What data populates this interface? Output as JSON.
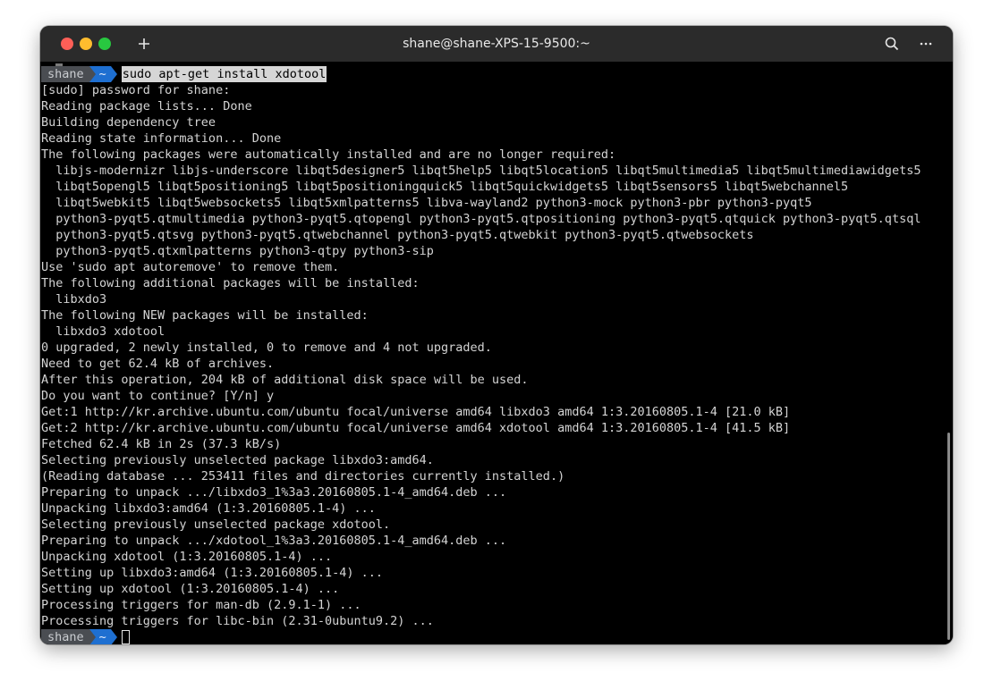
{
  "window": {
    "title": "shane@shane-XPS-15-9500:~",
    "new_tab_icon": "plus-icon",
    "search_icon": "search-icon",
    "menu_icon": "more-horizontal-icon"
  },
  "prompt": {
    "user": "shane",
    "dir": "~",
    "command": "sudo apt-get install xdotool"
  },
  "output_lines": [
    "[sudo] password for shane:",
    "Reading package lists... Done",
    "Building dependency tree",
    "Reading state information... Done",
    "The following packages were automatically installed and are no longer required:",
    "  libjs-modernizr libjs-underscore libqt5designer5 libqt5help5 libqt5location5 libqt5multimedia5 libqt5multimediawidgets5",
    "  libqt5opengl5 libqt5positioning5 libqt5positioningquick5 libqt5quickwidgets5 libqt5sensors5 libqt5webchannel5",
    "  libqt5webkit5 libqt5websockets5 libqt5xmlpatterns5 libva-wayland2 python3-mock python3-pbr python3-pyqt5",
    "  python3-pyqt5.qtmultimedia python3-pyqt5.qtopengl python3-pyqt5.qtpositioning python3-pyqt5.qtquick python3-pyqt5.qtsql",
    "  python3-pyqt5.qtsvg python3-pyqt5.qtwebchannel python3-pyqt5.qtwebkit python3-pyqt5.qtwebsockets",
    "  python3-pyqt5.qtxmlpatterns python3-qtpy python3-sip",
    "Use 'sudo apt autoremove' to remove them.",
    "The following additional packages will be installed:",
    "  libxdo3",
    "The following NEW packages will be installed:",
    "  libxdo3 xdotool",
    "0 upgraded, 2 newly installed, 0 to remove and 4 not upgraded.",
    "Need to get 62.4 kB of archives.",
    "After this operation, 204 kB of additional disk space will be used.",
    "Do you want to continue? [Y/n] y",
    "Get:1 http://kr.archive.ubuntu.com/ubuntu focal/universe amd64 libxdo3 amd64 1:3.20160805.1-4 [21.0 kB]",
    "Get:2 http://kr.archive.ubuntu.com/ubuntu focal/universe amd64 xdotool amd64 1:3.20160805.1-4 [41.5 kB]",
    "Fetched 62.4 kB in 2s (37.3 kB/s)",
    "Selecting previously unselected package libxdo3:amd64.",
    "(Reading database ... 253411 files and directories currently installed.)",
    "Preparing to unpack .../libxdo3_1%3a3.20160805.1-4_amd64.deb ...",
    "Unpacking libxdo3:amd64 (1:3.20160805.1-4) ...",
    "Selecting previously unselected package xdotool.",
    "Preparing to unpack .../xdotool_1%3a3.20160805.1-4_amd64.deb ...",
    "Unpacking xdotool (1:3.20160805.1-4) ...",
    "Setting up libxdo3:amd64 (1:3.20160805.1-4) ...",
    "Setting up xdotool (1:3.20160805.1-4) ...",
    "Processing triggers for man-db (2.9.1-1) ...",
    "Processing triggers for libc-bin (2.31-0ubuntu9.2) ..."
  ],
  "colors": {
    "titlebar": "#2b2b2b",
    "terminal_bg": "#000000",
    "terminal_fg": "#d4d4d4",
    "prompt_user_bg": "#4a4d52",
    "prompt_dir_bg": "#1e6fd1",
    "close": "#fe5f57",
    "minimize": "#febc2e",
    "maximize": "#28c840"
  }
}
